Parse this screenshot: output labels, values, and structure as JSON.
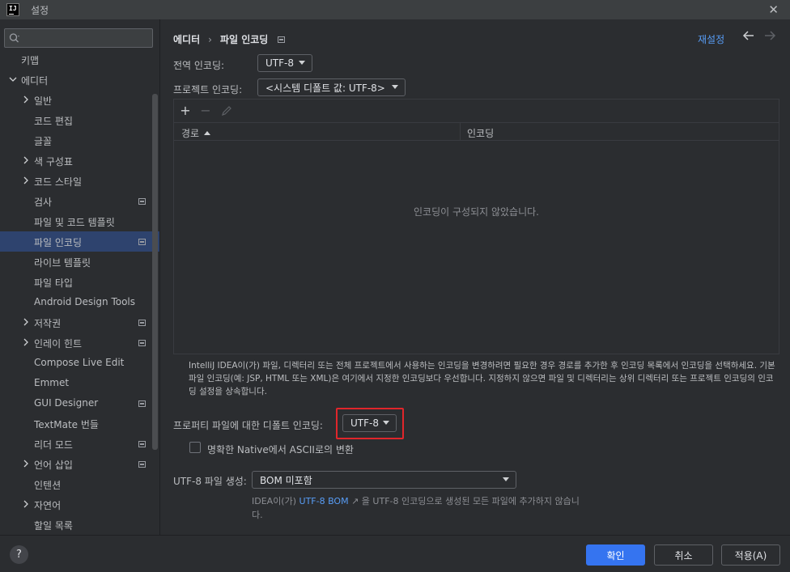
{
  "window": {
    "logo_text": "IJ",
    "title": "설정"
  },
  "sidebar": {
    "search_placeholder": "",
    "items": [
      {
        "label": "키맵",
        "expandable": false,
        "expanded": false,
        "badge": false,
        "selected": false
      },
      {
        "label": "에디터",
        "expandable": true,
        "expanded": true,
        "badge": false,
        "selected": false
      },
      {
        "label": "일반",
        "expandable": true,
        "expanded": false,
        "badge": false,
        "selected": false
      },
      {
        "label": "코드 편집",
        "expandable": false,
        "expanded": false,
        "badge": false,
        "selected": false
      },
      {
        "label": "글꼴",
        "expandable": false,
        "expanded": false,
        "badge": false,
        "selected": false
      },
      {
        "label": "색 구성표",
        "expandable": true,
        "expanded": false,
        "badge": false,
        "selected": false
      },
      {
        "label": "코드 스타일",
        "expandable": true,
        "expanded": false,
        "badge": false,
        "selected": false
      },
      {
        "label": "검사",
        "expandable": false,
        "expanded": false,
        "badge": true,
        "selected": false
      },
      {
        "label": "파일 및 코드 템플릿",
        "expandable": false,
        "expanded": false,
        "badge": false,
        "selected": false
      },
      {
        "label": "파일 인코딩",
        "expandable": false,
        "expanded": false,
        "badge": true,
        "selected": true
      },
      {
        "label": "라이브 템플릿",
        "expandable": false,
        "expanded": false,
        "badge": false,
        "selected": false
      },
      {
        "label": "파일 타입",
        "expandable": false,
        "expanded": false,
        "badge": false,
        "selected": false
      },
      {
        "label": "Android Design Tools",
        "expandable": false,
        "expanded": false,
        "badge": false,
        "selected": false
      },
      {
        "label": "저작권",
        "expandable": true,
        "expanded": false,
        "badge": true,
        "selected": false
      },
      {
        "label": "인레이 힌트",
        "expandable": true,
        "expanded": false,
        "badge": true,
        "selected": false
      },
      {
        "label": "Compose Live Edit",
        "expandable": false,
        "expanded": false,
        "badge": false,
        "selected": false
      },
      {
        "label": "Emmet",
        "expandable": false,
        "expanded": false,
        "badge": false,
        "selected": false
      },
      {
        "label": "GUI Designer",
        "expandable": false,
        "expanded": false,
        "badge": true,
        "selected": false
      },
      {
        "label": "TextMate 번들",
        "expandable": false,
        "expanded": false,
        "badge": false,
        "selected": false
      },
      {
        "label": "리더 모드",
        "expandable": false,
        "expanded": false,
        "badge": true,
        "selected": false
      },
      {
        "label": "언어 삽입",
        "expandable": true,
        "expanded": false,
        "badge": true,
        "selected": false
      },
      {
        "label": "인텐션",
        "expandable": false,
        "expanded": false,
        "badge": false,
        "selected": false
      },
      {
        "label": "자연어",
        "expandable": true,
        "expanded": false,
        "badge": false,
        "selected": false
      },
      {
        "label": "할일 목록",
        "expandable": false,
        "expanded": false,
        "badge": false,
        "selected": false
      }
    ]
  },
  "header": {
    "breadcrumb_parent": "에디터",
    "breadcrumb_separator": "›",
    "breadcrumb_current": "파일 인코딩",
    "reset_label": "재설정"
  },
  "settings": {
    "global_encoding_label": "전역 인코딩:",
    "global_encoding_value": "UTF-8",
    "project_encoding_label": "프로젝트 인코딩:",
    "project_encoding_value": "<시스템 디폴트 값: UTF-8>",
    "properties_label": "프로퍼티 파일에 대한 디폴트 인코딩:",
    "properties_value": "UTF-8",
    "native_to_ascii_label": "명확한 Native에서 ASCII로의 변환",
    "native_to_ascii_checked": false,
    "utf8_file_label": "UTF-8 파일 생성:",
    "utf8_file_value": "BOM 미포함",
    "hint_prefix": "IDEA이(가) ",
    "hint_link": "UTF-8 BOM",
    "hint_link_arrow": "↗",
    "hint_suffix": " 을 UTF-8 인코딩으로 생성된 모든 파일에 추가하지 않습니다."
  },
  "table": {
    "toolbar_add": "+",
    "toolbar_remove": "−",
    "col_path": "경로",
    "col_encoding": "인코딩",
    "empty_text": "인코딩이 구성되지 않았습니다."
  },
  "description": "IntelliJ IDEA이(가) 파일, 디렉터리 또는 전체 프로젝트에서 사용하는 인코딩을 변경하려면 필요한 경우 경로를 추가한 후 인코딩 목록에서 인코딩을 선택하세요. 기본 파일 인코딩(예: JSP, HTML 또는 XML)은 여기에서 지정한 인코딩보다 우선합니다. 지정하지 않으면 파일 및 디렉터리는 상위 디렉터리 또는 프로젝트 인코딩의 인코딩 설정을 상속합니다.",
  "footer": {
    "help": "?",
    "ok": "확인",
    "cancel": "취소",
    "apply": "적용(A)"
  },
  "colors": {
    "accent": "#3574f0",
    "link": "#589df6",
    "selection": "#2e436e",
    "highlight_border": "#e0262b"
  }
}
